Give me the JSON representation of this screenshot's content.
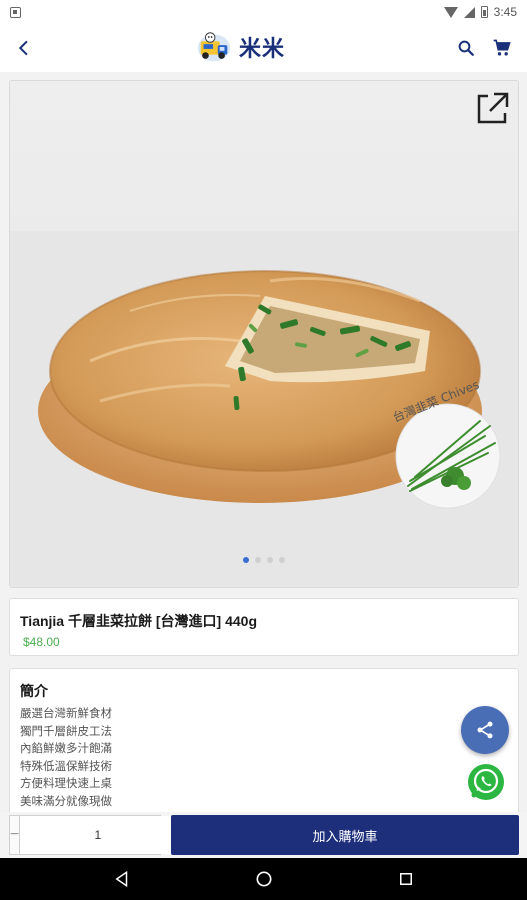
{
  "status_bar": {
    "time": "3:45",
    "icons": [
      "notification-icon",
      "wifi-icon",
      "signal-icon",
      "battery-icon"
    ]
  },
  "app_bar": {
    "logo_text": "米米",
    "back_icon": "back-arrow-icon",
    "search_icon": "search-icon",
    "cart_icon": "cart-icon",
    "brand_color": "#1a2f7a"
  },
  "gallery": {
    "overlay_text": "台灣韭菜 Chives",
    "slide_count": 4,
    "active_slide": 1,
    "open_icon": "open-external-icon"
  },
  "product": {
    "title": "Tianjia 千層韭菜拉餅 [台灣進口] 440g",
    "price": "$48.00",
    "price_color": "#4caf50"
  },
  "intro": {
    "heading": "簡介",
    "lines": [
      "嚴選台灣新鮮食材",
      "獨門千層餅皮工法",
      "內餡鮮嫩多汁飽滿",
      "特殊低溫保鮮技術",
      "方便料理快速上桌",
      "美味滿分就像現做"
    ]
  },
  "fabs": {
    "share_icon": "share-icon",
    "whatsapp_icon": "whatsapp-icon",
    "share_color": "#4a6eb6"
  },
  "cart_bar": {
    "minus": "−",
    "plus": "+",
    "quantity": "1",
    "add_to_cart_label": "加入購物車",
    "button_color": "#1d2f7b"
  },
  "nav_bar": {
    "icons": [
      "back-triangle-icon",
      "home-circle-icon",
      "recents-square-icon"
    ]
  }
}
